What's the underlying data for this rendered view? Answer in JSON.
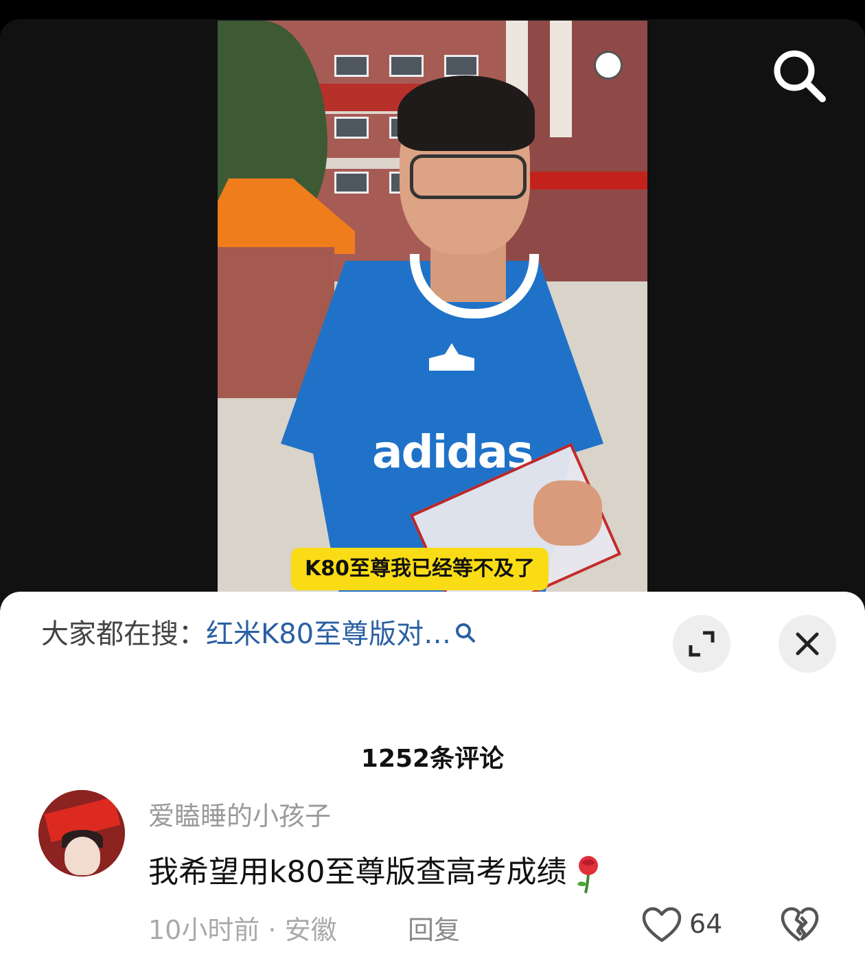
{
  "video": {
    "subtitle": "K80至尊我已经等不及了",
    "shirt_logo": "adidas"
  },
  "hot_search": {
    "prefix": "大家都在搜：",
    "query": "红米K80至尊版对…"
  },
  "comments": {
    "count_label": "1252条评论",
    "items": [
      {
        "username": "爱瞌睡的小孩子",
        "text": "我希望用k80至尊版查高考成绩",
        "time_location": "10小时前 · 安徽",
        "reply_label": "回复",
        "likes": "64"
      }
    ]
  },
  "icons": {
    "search": "search-icon",
    "expand": "expand-icon",
    "close": "close-icon",
    "like": "heart-icon",
    "dislike": "broken-heart-icon",
    "emoji": "rose-emoji-icon"
  },
  "colors": {
    "link": "#2a5fa4",
    "subtitle_bg": "#f9dc16"
  }
}
